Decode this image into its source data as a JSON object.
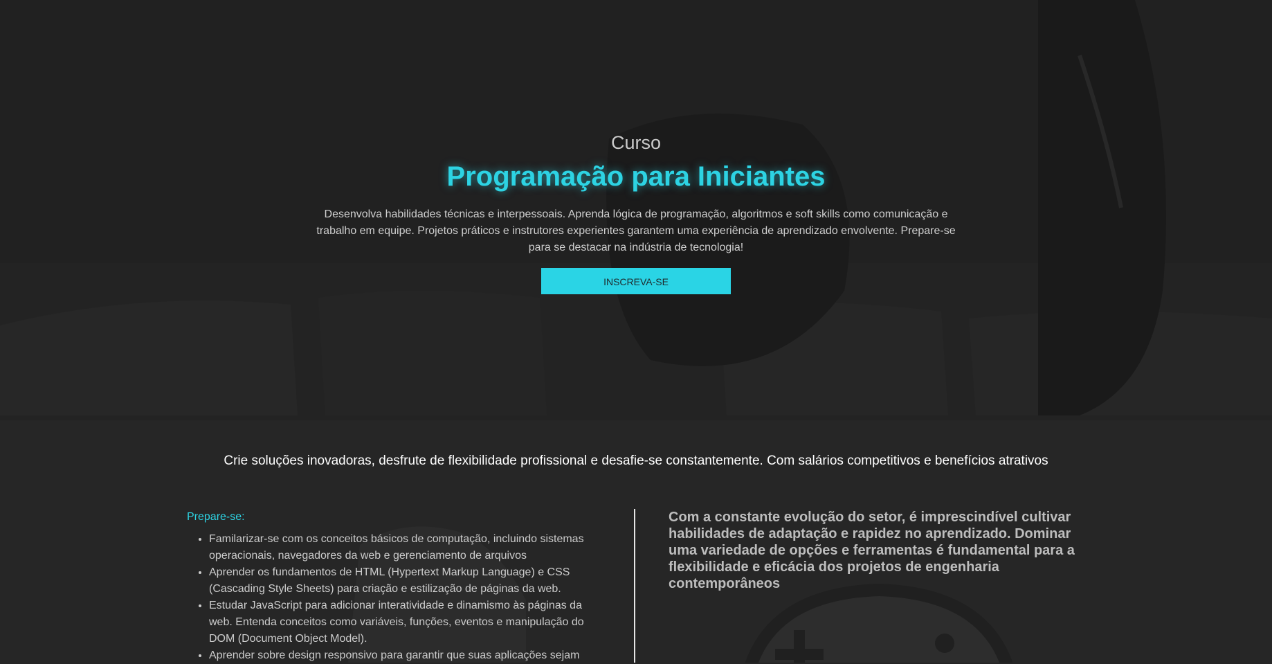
{
  "hero": {
    "kicker": "Curso",
    "title": "Programação para Iniciantes",
    "description": "Desenvolva habilidades técnicas e interpessoais. Aprenda lógica de programação, algoritmos e soft skills como comunicação e trabalho em equipe. Projetos práticos e instrutores experientes garantem uma experiência de aprendizado envolvente. Prepare-se para se destacar na indústria de tecnologia!",
    "cta_label": "INSCREVA-SE"
  },
  "tagline": "Crie soluções inovadoras, desfrute de flexibilidade profissional e desafie-se constantemente. Com salários competitivos e benefícios atrativos",
  "prepare": {
    "label": "Prepare-se:",
    "items": [
      "Familarizar-se com os conceitos básicos de computação, incluindo sistemas operacionais, navegadores da web e gerenciamento de arquivos",
      "Aprender os fundamentos de HTML (Hypertext Markup Language) e CSS (Cascading Style Sheets) para criação e estilização de páginas da web.",
      "Estudar JavaScript para adicionar interatividade e dinamismo às páginas da web. Entenda conceitos como variáveis, funções, eventos e manipulação do DOM (Document Object Model).",
      "Aprender sobre design responsivo para garantir que suas aplicações sejam"
    ]
  },
  "evolution_text": "Com a constante evolução do setor, é imprescindível cultivar habilidades de adaptação e rapidez no aprendizado. Dominar uma variedade de opções e ferramentas é fundamental para a flexibilidade e eficácia dos projetos de engenharia contemporâneos",
  "colors": {
    "accent": "#2ad4e5",
    "background": "#262626"
  }
}
